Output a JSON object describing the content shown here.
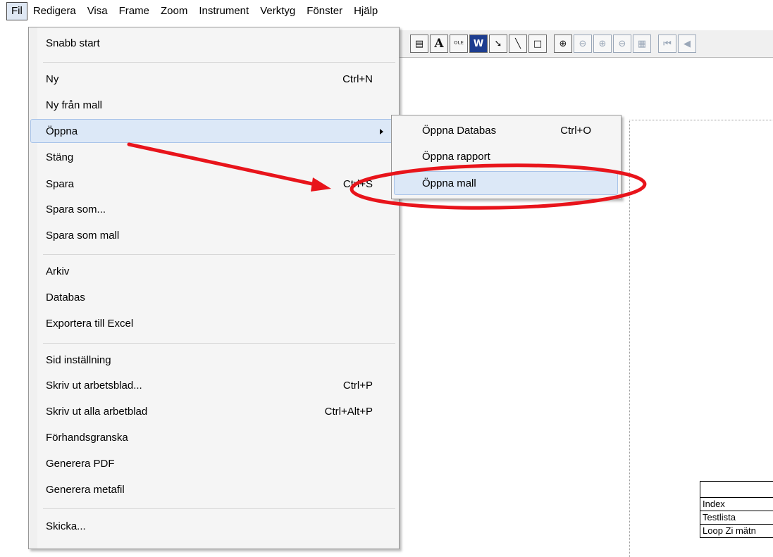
{
  "menubar": {
    "items": [
      "Fil",
      "Redigera",
      "Visa",
      "Frame",
      "Zoom",
      "Instrument",
      "Verktyg",
      "Fönster",
      "Hjälp"
    ]
  },
  "toolbar": {
    "buttons": [
      {
        "icon": "table-icon",
        "glyph": "▤"
      },
      {
        "icon": "text-icon",
        "glyph": "A"
      },
      {
        "icon": "ole-icon",
        "glyph": "ᴼᴸᴱ"
      },
      {
        "icon": "word-icon",
        "glyph": "W"
      },
      {
        "icon": "arrow-tool-icon",
        "glyph": "➘"
      },
      {
        "icon": "line-tool-icon",
        "glyph": "╲"
      },
      {
        "icon": "rectangle-tool-icon",
        "glyph": "□"
      },
      {
        "icon": "zoom-in-icon",
        "glyph": "⊕"
      },
      {
        "icon": "zoom-out-icon",
        "glyph": "⊖"
      },
      {
        "icon": "zoom-plus-icon",
        "glyph": "⊕"
      },
      {
        "icon": "zoom-minus-icon",
        "glyph": "⊖"
      },
      {
        "icon": "page-icon",
        "glyph": "▦"
      },
      {
        "icon": "first-page-icon",
        "glyph": "⏮"
      },
      {
        "icon": "prev-page-icon",
        "glyph": "◀"
      }
    ]
  },
  "menu": {
    "items": [
      {
        "label": "Snabb start",
        "shortcut": ""
      },
      {
        "label": "Ny",
        "shortcut": "Ctrl+N"
      },
      {
        "label": "Ny från mall",
        "shortcut": ""
      },
      {
        "label": "Öppna",
        "shortcut": ""
      },
      {
        "label": "Stäng",
        "shortcut": ""
      },
      {
        "label": "Spara",
        "shortcut": "Ctrl+S"
      },
      {
        "label": "Spara som...",
        "shortcut": ""
      },
      {
        "label": "Spara som mall",
        "shortcut": ""
      },
      {
        "label": "Arkiv",
        "shortcut": ""
      },
      {
        "label": "Databas",
        "shortcut": ""
      },
      {
        "label": "Exportera till Excel",
        "shortcut": ""
      },
      {
        "label": "Sid inställning",
        "shortcut": ""
      },
      {
        "label": "Skriv ut arbetsblad...",
        "shortcut": "Ctrl+P"
      },
      {
        "label": "Skriv ut alla arbetblad",
        "shortcut": "Ctrl+Alt+P"
      },
      {
        "label": "Förhandsgranska",
        "shortcut": ""
      },
      {
        "label": "Generera PDF",
        "shortcut": ""
      },
      {
        "label": "Generera metafil",
        "shortcut": ""
      },
      {
        "label": "Skicka...",
        "shortcut": ""
      }
    ]
  },
  "submenu": {
    "items": [
      {
        "label": "Öppna Databas",
        "shortcut": "Ctrl+O"
      },
      {
        "label": "Öppna rapport",
        "shortcut": ""
      },
      {
        "label": "Öppna mall",
        "shortcut": ""
      }
    ]
  },
  "titleblock": {
    "rows": [
      "",
      "Index",
      "Testlista",
      "Loop Zi mätn"
    ]
  },
  "colors": {
    "highlight_bg": "#dce8f7",
    "highlight_border": "#a9c4e9",
    "annotation_red": "#e8141b"
  }
}
